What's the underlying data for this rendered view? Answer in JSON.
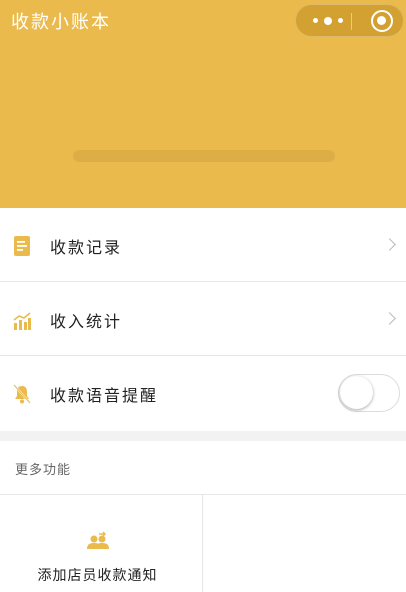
{
  "header": {
    "title": "收款小账本",
    "capsule": {
      "more_icon": "more-dots-icon",
      "close_icon": "target-circle-icon"
    },
    "accent_color": "#eaba4d"
  },
  "menu": {
    "items": [
      {
        "label": "收款记录",
        "icon": "document-icon",
        "trailing": "chevron-right-icon"
      },
      {
        "label": "收入统计",
        "icon": "bar-chart-icon",
        "trailing": "chevron-right-icon"
      },
      {
        "label": "收款语音提醒",
        "icon": "bell-off-icon",
        "trailing": "toggle",
        "toggle_on": false
      }
    ]
  },
  "more": {
    "title": "更多功能",
    "features": [
      {
        "label": "添加店员收款通知",
        "icon": "staff-add-icon"
      }
    ]
  }
}
